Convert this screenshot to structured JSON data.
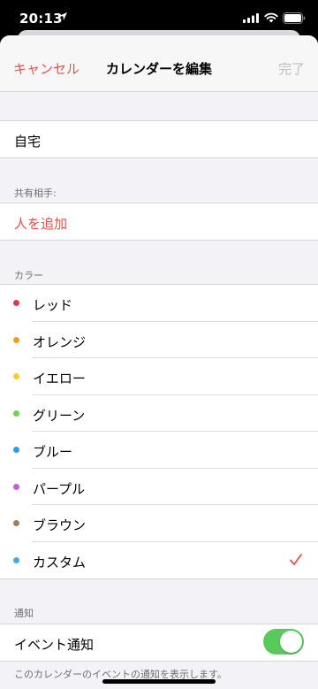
{
  "status_bar": {
    "time": "20:13"
  },
  "nav": {
    "cancel_label": "キャンセル",
    "title": "カレンダーを編集",
    "done_label": "完了"
  },
  "calendar_name": "自宅",
  "shared_section": {
    "header": "共有相手:",
    "add_person_label": "人を追加"
  },
  "color_section": {
    "header": "カラー",
    "items": [
      {
        "label": "レッド",
        "color": "#e5344f"
      },
      {
        "label": "オレンジ",
        "color": "#f59a23"
      },
      {
        "label": "イエロー",
        "color": "#f8cd2c"
      },
      {
        "label": "グリーン",
        "color": "#73d14d"
      },
      {
        "label": "ブルー",
        "color": "#2f9bf0"
      },
      {
        "label": "パープル",
        "color": "#c55ed8"
      },
      {
        "label": "ブラウン",
        "color": "#9a7f61"
      },
      {
        "label": "カスタム",
        "color": "#4aa7e0",
        "selected": true
      }
    ]
  },
  "notification_section": {
    "header": "通知",
    "event_notification_label": "イベント通知",
    "event_notification_enabled": true,
    "footer": "このカレンダーのイベントの通知を表示します。"
  },
  "colors": {
    "accent": "#e8504a",
    "toggle_on": "#5ac95c",
    "disabled": "#bdbdc1"
  }
}
